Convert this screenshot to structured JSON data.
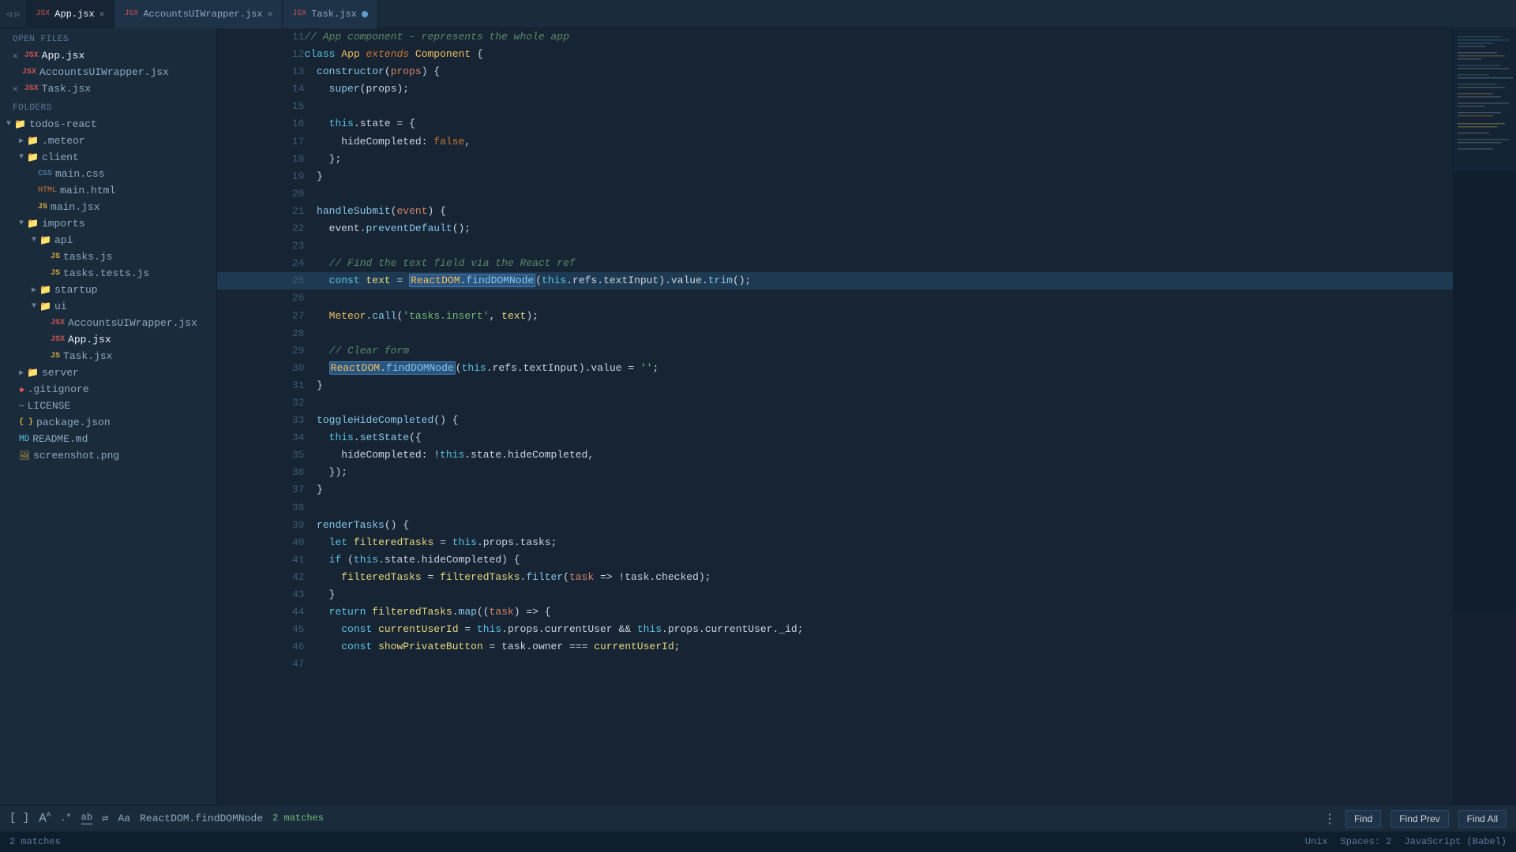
{
  "tabs": [
    {
      "id": "app-jsx",
      "label": "App.jsx",
      "active": true,
      "hasClose": true,
      "hasDot": false,
      "type": "jsx-red"
    },
    {
      "id": "accounts-ui",
      "label": "AccountsUIWrapper.jsx",
      "active": false,
      "hasClose": true,
      "hasDot": false,
      "type": "jsx-red"
    },
    {
      "id": "task-jsx",
      "label": "Task.jsx",
      "active": false,
      "hasClose": false,
      "hasDot": true,
      "type": "jsx-red"
    }
  ],
  "sidebar": {
    "open_files_label": "OPEN FILES",
    "folders_label": "FOLDERS",
    "open_files": [
      {
        "id": "app-jsx",
        "label": "App.jsx",
        "active": true,
        "hasX": true,
        "type": "jsx-red"
      },
      {
        "id": "accounts-ui",
        "label": "AccountsUIWrapper.jsx",
        "active": false,
        "hasX": false,
        "type": "jsx-red"
      },
      {
        "id": "task-jsx",
        "label": "Task.jsx",
        "active": false,
        "hasX": true,
        "type": "jsx-red"
      }
    ],
    "tree": [
      {
        "id": "todos-react",
        "label": "todos-react",
        "type": "folder",
        "indent": 0,
        "expanded": true
      },
      {
        "id": "meteor",
        "label": ".meteor",
        "type": "folder",
        "indent": 1,
        "expanded": false
      },
      {
        "id": "client",
        "label": "client",
        "type": "folder",
        "indent": 1,
        "expanded": true
      },
      {
        "id": "main-css",
        "label": "main.css",
        "type": "css",
        "indent": 2
      },
      {
        "id": "main-html",
        "label": "main.html",
        "type": "html",
        "indent": 2
      },
      {
        "id": "main-jsx",
        "label": "main.jsx",
        "type": "jsx",
        "indent": 2
      },
      {
        "id": "imports",
        "label": "imports",
        "type": "folder",
        "indent": 1,
        "expanded": true
      },
      {
        "id": "api",
        "label": "api",
        "type": "folder",
        "indent": 2,
        "expanded": true
      },
      {
        "id": "tasks-js",
        "label": "tasks.js",
        "type": "js",
        "indent": 3
      },
      {
        "id": "tasks-tests-js",
        "label": "tasks.tests.js",
        "type": "js",
        "indent": 3
      },
      {
        "id": "startup",
        "label": "startup",
        "type": "folder",
        "indent": 2,
        "expanded": false
      },
      {
        "id": "ui",
        "label": "ui",
        "type": "folder",
        "indent": 2,
        "expanded": true
      },
      {
        "id": "accounts-ui-wrapper",
        "label": "AccountsUIWrapper.jsx",
        "type": "jsx-red",
        "indent": 3
      },
      {
        "id": "app-jsx-tree",
        "label": "App.jsx",
        "type": "jsx-active",
        "indent": 3
      },
      {
        "id": "task-jsx-tree",
        "label": "Task.jsx",
        "type": "jsx",
        "indent": 3
      },
      {
        "id": "server",
        "label": "server",
        "type": "folder",
        "indent": 1,
        "expanded": false
      },
      {
        "id": "gitignore",
        "label": ".gitignore",
        "type": "git",
        "indent": 1
      },
      {
        "id": "license",
        "label": "LICENSE",
        "type": "file",
        "indent": 1
      },
      {
        "id": "package-json",
        "label": "package.json",
        "type": "json",
        "indent": 1
      },
      {
        "id": "readme",
        "label": "README.md",
        "type": "md",
        "indent": 1
      },
      {
        "id": "screenshot",
        "label": "screenshot.png",
        "type": "png",
        "indent": 1
      }
    ]
  },
  "code": {
    "lines": [
      {
        "num": 11,
        "content": "// App component - represents the whole app",
        "type": "comment",
        "highlighted": false
      },
      {
        "num": 12,
        "content": "class App extends Component {",
        "type": "code",
        "highlighted": false
      },
      {
        "num": 13,
        "content": "  constructor(props) {",
        "type": "code",
        "highlighted": false
      },
      {
        "num": 14,
        "content": "    super(props);",
        "type": "code",
        "highlighted": false
      },
      {
        "num": 15,
        "content": "",
        "type": "code",
        "highlighted": false
      },
      {
        "num": 16,
        "content": "    this.state = {",
        "type": "code",
        "highlighted": false
      },
      {
        "num": 17,
        "content": "      hideCompleted: false,",
        "type": "code",
        "highlighted": false
      },
      {
        "num": 18,
        "content": "    };",
        "type": "code",
        "highlighted": false
      },
      {
        "num": 19,
        "content": "  }",
        "type": "code",
        "highlighted": false
      },
      {
        "num": 20,
        "content": "",
        "type": "code",
        "highlighted": false
      },
      {
        "num": 21,
        "content": "  handleSubmit(event) {",
        "type": "code",
        "highlighted": false
      },
      {
        "num": 22,
        "content": "    event.preventDefault();",
        "type": "code",
        "highlighted": false
      },
      {
        "num": 23,
        "content": "",
        "type": "code",
        "highlighted": false
      },
      {
        "num": 24,
        "content": "    // Find the text field via the React ref",
        "type": "comment",
        "highlighted": false
      },
      {
        "num": 25,
        "content": "    const text = ReactDOM.findDOMNode(this.refs.textInput).value.trim();",
        "type": "code",
        "highlighted": true
      },
      {
        "num": 26,
        "content": "",
        "type": "code",
        "highlighted": false
      },
      {
        "num": 27,
        "content": "    Meteor.call('tasks.insert', text);",
        "type": "code",
        "highlighted": false
      },
      {
        "num": 28,
        "content": "",
        "type": "code",
        "highlighted": false
      },
      {
        "num": 29,
        "content": "    // Clear form",
        "type": "comment",
        "highlighted": false
      },
      {
        "num": 30,
        "content": "    ReactDOM.findDOMNode(this.refs.textInput).value = '';",
        "type": "code",
        "highlighted": false
      },
      {
        "num": 31,
        "content": "  }",
        "type": "code",
        "highlighted": false
      },
      {
        "num": 32,
        "content": "",
        "type": "code",
        "highlighted": false
      },
      {
        "num": 33,
        "content": "  toggleHideCompleted() {",
        "type": "code",
        "highlighted": false
      },
      {
        "num": 34,
        "content": "    this.setState({",
        "type": "code",
        "highlighted": false
      },
      {
        "num": 35,
        "content": "      hideCompleted: !this.state.hideCompleted,",
        "type": "code",
        "highlighted": false
      },
      {
        "num": 36,
        "content": "    });",
        "type": "code",
        "highlighted": false
      },
      {
        "num": 37,
        "content": "  }",
        "type": "code",
        "highlighted": false
      },
      {
        "num": 38,
        "content": "",
        "type": "code",
        "highlighted": false
      },
      {
        "num": 39,
        "content": "  renderTasks() {",
        "type": "code",
        "highlighted": false
      },
      {
        "num": 40,
        "content": "    let filteredTasks = this.props.tasks;",
        "type": "code",
        "highlighted": false
      },
      {
        "num": 41,
        "content": "    if (this.state.hideCompleted) {",
        "type": "code",
        "highlighted": false
      },
      {
        "num": 42,
        "content": "      filteredTasks = filteredTasks.filter(task => !task.checked);",
        "type": "code",
        "highlighted": false
      },
      {
        "num": 43,
        "content": "    }",
        "type": "code",
        "highlighted": false
      },
      {
        "num": 44,
        "content": "    return filteredTasks.map((task) => {",
        "type": "code",
        "highlighted": false
      },
      {
        "num": 45,
        "content": "      const currentUserId = this.props.currentUser && this.props.currentUser._id;",
        "type": "code",
        "highlighted": false
      },
      {
        "num": 46,
        "content": "      const showPrivateButton = task.owner === currentUserId;",
        "type": "code",
        "highlighted": false
      },
      {
        "num": 47,
        "content": "",
        "type": "code",
        "highlighted": false
      }
    ]
  },
  "status_bar": {
    "match_count": "2 matches",
    "encoding": "Unix",
    "spaces": "Spaces: 2",
    "language": "JavaScript (Babel)"
  },
  "bottom_toolbar": {
    "search_text": "ReactDOM.findDOMNode",
    "find_label": "Find",
    "find_prev_label": "Find Prev",
    "find_all_label": "Find All"
  },
  "colors": {
    "bg": "#162433",
    "sidebar_bg": "#1a2b3c",
    "highlight_line": "#1e3a52",
    "tab_active": "#162433",
    "keyword": "#cc7733",
    "keyword2": "#5bc4e6",
    "string": "#77bb77",
    "comment": "#5b8a6a",
    "class_name": "#f0c060",
    "function": "#88c8e8",
    "variable": "#e8d880",
    "number": "#cc9966",
    "boolean": "#cc7733",
    "selected_highlight": "#2a5580"
  }
}
